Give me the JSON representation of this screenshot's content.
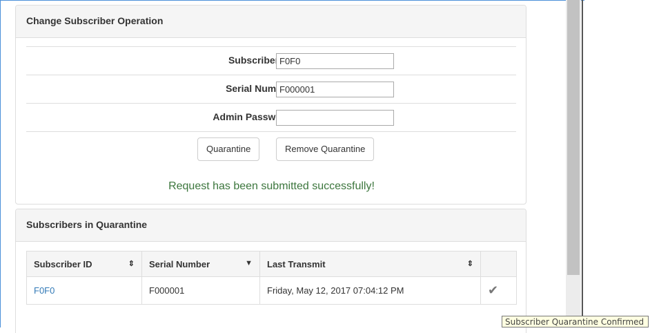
{
  "change_panel": {
    "title": "Change Subscriber Operation",
    "fields": {
      "subscriber_id": {
        "label": "Subscriber ID",
        "value": "F0F0"
      },
      "serial_number": {
        "label": "Serial Number",
        "value": "F000001"
      },
      "admin_password": {
        "label": "Admin Password",
        "value": ""
      }
    },
    "buttons": {
      "quarantine": "Quarantine",
      "remove_quarantine": "Remove Quarantine"
    },
    "success_message": "Request has been submitted successfully!"
  },
  "quarantine_panel": {
    "title": "Subscribers in Quarantine",
    "columns": [
      "Subscriber ID",
      "Serial Number",
      "Last Transmit"
    ],
    "rows": [
      {
        "subscriber_id": "F0F0",
        "serial_number": "F000001",
        "last_transmit": "Friday, May 12, 2017 07:04:12 PM",
        "status_icon": "check-icon"
      }
    ]
  },
  "tooltip": "Subscriber Quarantine Confirmed",
  "colors": {
    "success": "#3c763d",
    "link": "#337ab7",
    "panel_heading": "#f5f5f5"
  }
}
